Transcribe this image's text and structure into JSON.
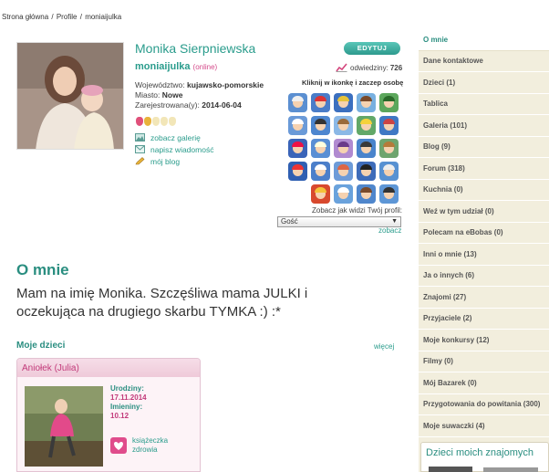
{
  "breadcrumb": {
    "home": "Strona główna",
    "sep": " / ",
    "profile": "Profile",
    "user": "moniaijulka"
  },
  "profile": {
    "name": "Monika Sierpniewska",
    "login": "moniaijulka",
    "status": "(online)",
    "voivodeship_label": "Województwo:",
    "voivodeship": "kujawsko-pomorskie",
    "city_label": "Miasto:",
    "city": "Nowe",
    "registered_label": "Zarejestrowana(y):",
    "registered": "2014-06-04"
  },
  "actions": {
    "edit": "EDYTUJ",
    "visits_label": "odwiedziny:",
    "visits": "726",
    "click_hint": "Kliknij w ikonkę i zaczep osobę",
    "gallery": "zobacz galerię",
    "message": "napisz wiadomość",
    "blog": "mój blog"
  },
  "view_as": {
    "label": "Zobacz jak widzi Twój profil:",
    "selected": "Gość",
    "button": "zobacz"
  },
  "about": {
    "title": "O mnie",
    "text": "Mam na imię Monika. Szczęśliwa mama JULKI i oczekująca na drugiego skarbu TYMKA :) :*"
  },
  "kids": {
    "title": "Moje dzieci",
    "more": "więcej",
    "child": {
      "name": "Aniołek (Julia)",
      "birthday_label": "Urodziny:",
      "birthday": "17.11.2014",
      "nameday_label": "Imieniny:",
      "nameday": "10.12",
      "health_book": "książeczka zdrowia"
    }
  },
  "sidebar": {
    "items": [
      "O mnie",
      "Dane kontaktowe",
      "Dzieci (1)",
      "Tablica",
      "Galeria (101)",
      "Blog (9)",
      "Forum (318)",
      "Kuchnia (0)",
      "Weź w tym udział (0)",
      "Polecam na eBobas (0)",
      "Inni o mnie (13)",
      "Ja o innych (6)",
      "Znajomi (27)",
      "Przyjaciele (2)",
      "Moje konkursy (12)",
      "Filmy (0)",
      "Mój Bazarek (0)",
      "Przygotowania do powitania (300)",
      "Moje suwaczki (4)"
    ],
    "friends_kids": "Dzieci moich znajomych"
  },
  "colors": {
    "accent": "#2a8e80",
    "pink": "#c23a7a",
    "sidebar_bg": "#f2eedd"
  }
}
